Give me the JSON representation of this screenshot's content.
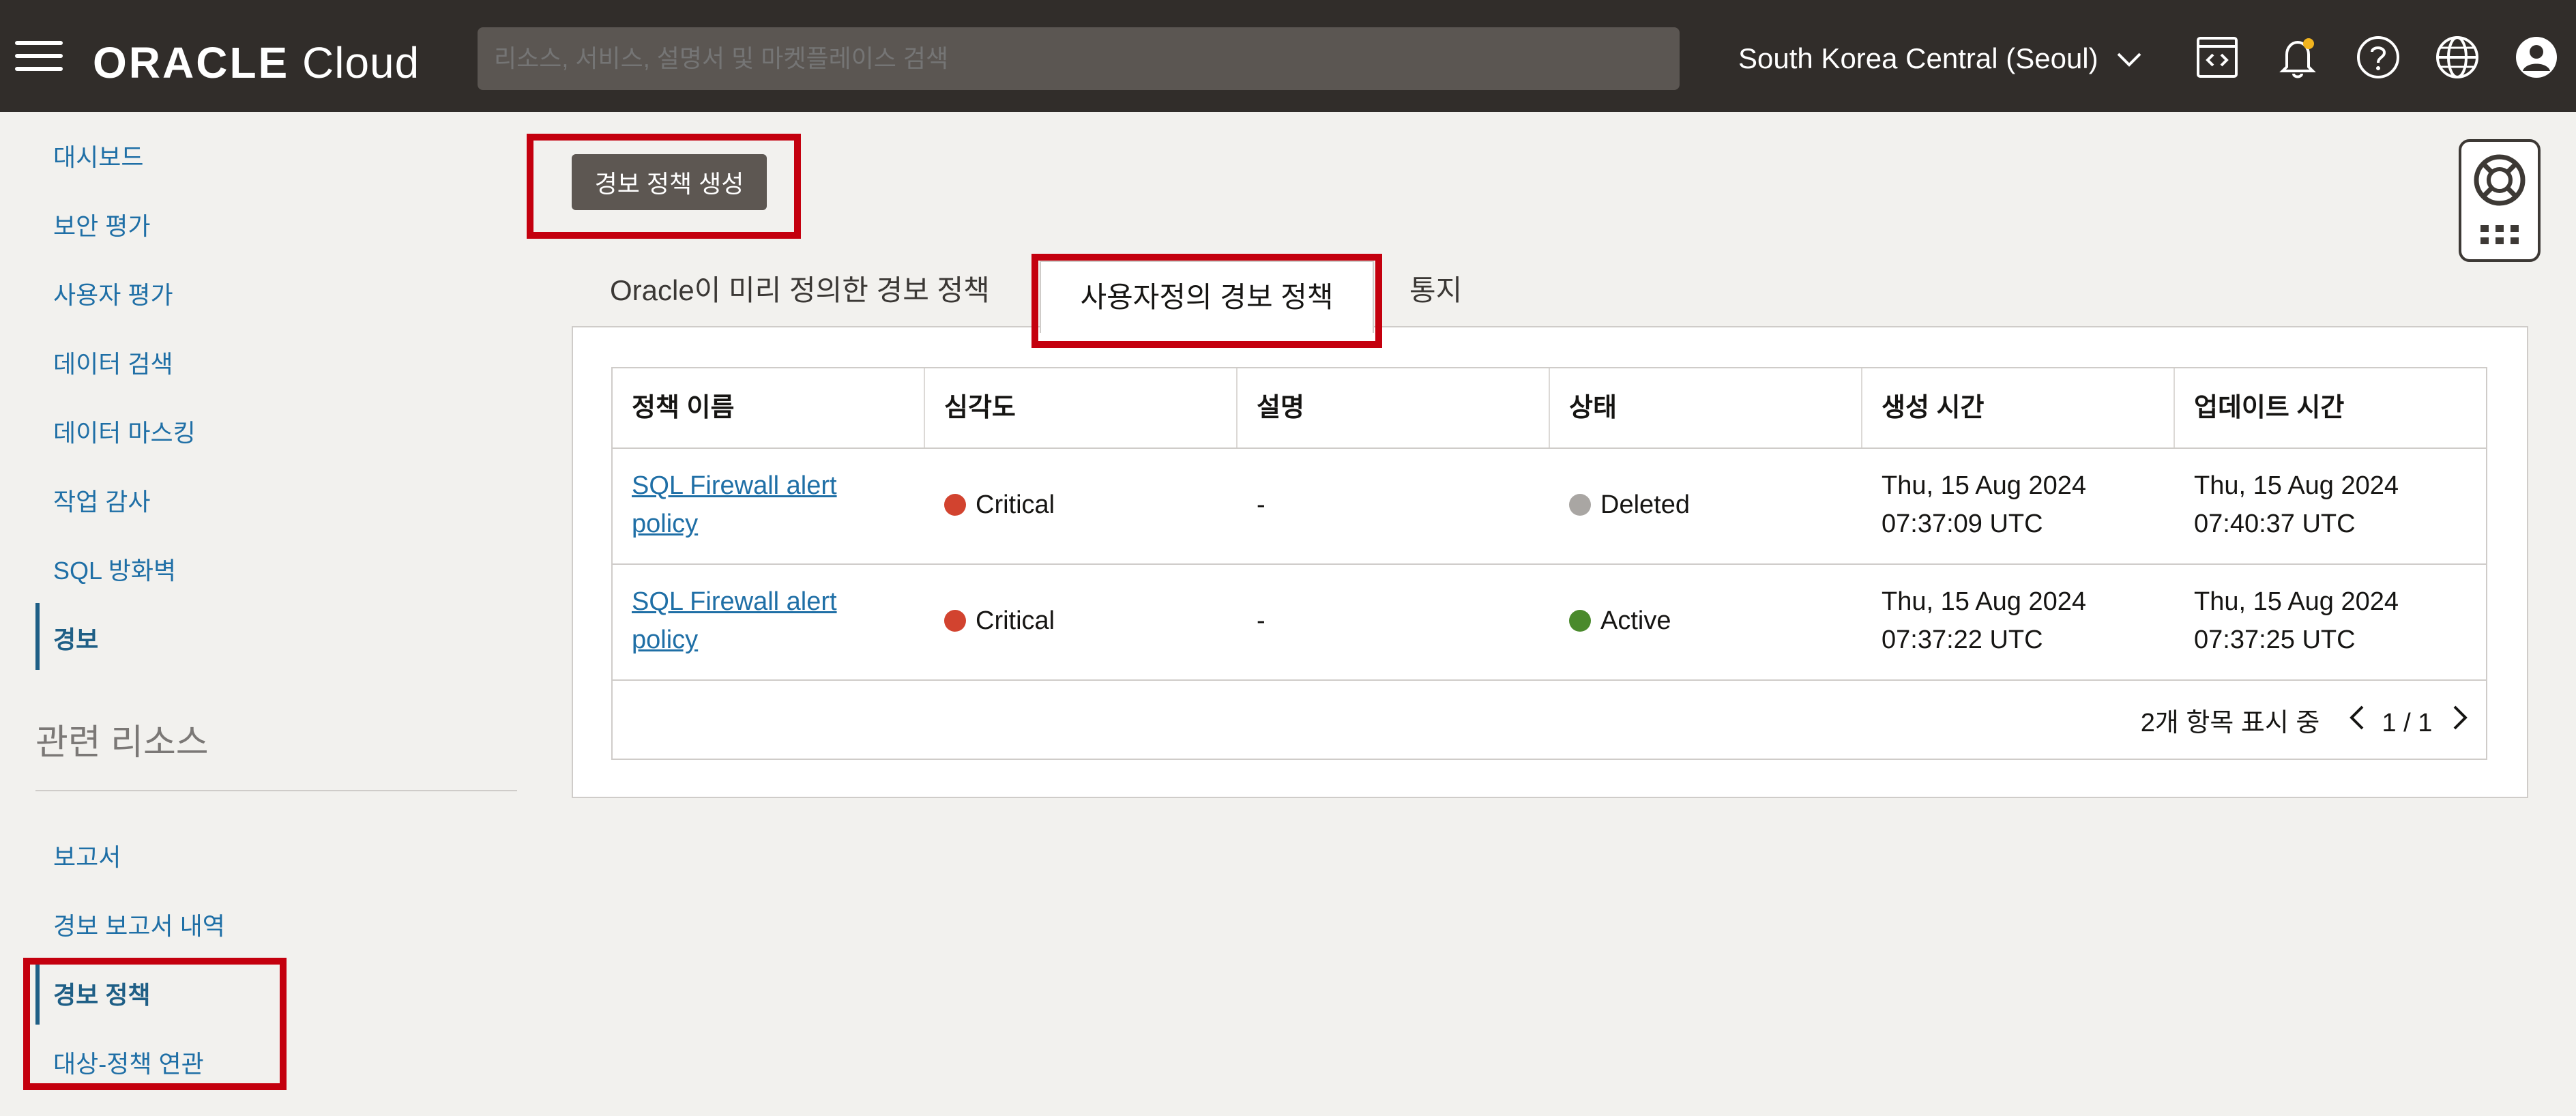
{
  "header": {
    "brand_bold": "ORACLE",
    "brand_light": "Cloud",
    "search_placeholder": "리소스, 서비스, 설명서 및 마켓플레이스 검색",
    "region": "South Korea Central (Seoul)"
  },
  "sidebar": {
    "items": [
      "대시보드",
      "보안 평가",
      "사용자 평가",
      "데이터 검색",
      "데이터 마스킹",
      "작업 감사",
      "SQL 방화벽",
      "경보"
    ],
    "related_title": "관련 리소스",
    "related_items": [
      "보고서",
      "경보 보고서 내역",
      "경보 정책",
      "대상-정책 연관"
    ]
  },
  "main": {
    "create_button": "경보 정책 생성",
    "tabs": [
      "Oracle이 미리 정의한 경보 정책",
      "사용자정의 경보 정책",
      "통지"
    ],
    "table": {
      "columns": [
        "정책 이름",
        "심각도",
        "설명",
        "상태",
        "생성 시간",
        "업데이트 시간"
      ],
      "rows": [
        {
          "name_line1": "SQL Firewall alert",
          "name_line2": "policy",
          "severity": "Critical",
          "description": "-",
          "status": "Deleted",
          "created_line1": "Thu, 15 Aug 2024",
          "created_line2": "07:37:09 UTC",
          "updated_line1": "Thu, 15 Aug 2024",
          "updated_line2": "07:40:37 UTC"
        },
        {
          "name_line1": "SQL Firewall alert",
          "name_line2": "policy",
          "severity": "Critical",
          "description": "-",
          "status": "Active",
          "created_line1": "Thu, 15 Aug 2024",
          "created_line2": "07:37:22 UTC",
          "updated_line1": "Thu, 15 Aug 2024",
          "updated_line2": "07:37:25 UTC"
        }
      ],
      "footer_count": "2개 항목 표시 중",
      "page": "1 / 1"
    }
  },
  "colors": {
    "critical": "#d2432f",
    "deleted": "#a9a6a3",
    "active": "#4a8a2c",
    "highlight": "#c4000e"
  },
  "icons": [
    "menu-icon",
    "code-editor-icon",
    "bell-icon",
    "help-icon",
    "globe-icon",
    "user-icon",
    "lifebuoy-icon",
    "grid-icon",
    "chevron-down-icon",
    "chevron-left-icon",
    "chevron-right-icon"
  ]
}
